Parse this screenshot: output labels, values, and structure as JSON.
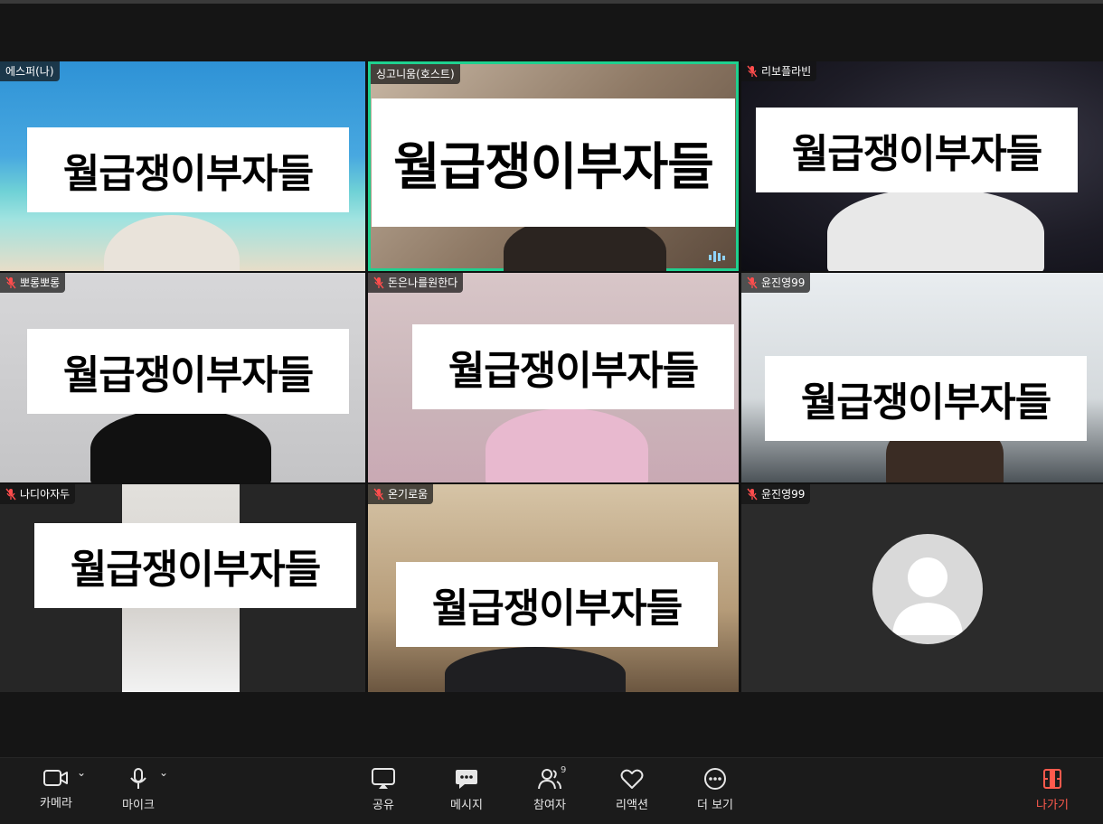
{
  "participants": [
    {
      "name": "에스퍼(나)",
      "muted": false,
      "banner": "월급쟁이부자들"
    },
    {
      "name": "싱고니움(호스트)",
      "muted": false,
      "banner": "월급쟁이부자들",
      "active_speaker": true
    },
    {
      "name": "리보플라빈",
      "muted": true,
      "banner": "월급쟁이부자들"
    },
    {
      "name": "뽀롱뽀롱",
      "muted": true,
      "banner": "월급쟁이부자들"
    },
    {
      "name": "돈은나를원한다",
      "muted": true,
      "banner": "월급쟁이부자들"
    },
    {
      "name": "윤진영99",
      "muted": true,
      "banner": "월급쟁이부자들"
    },
    {
      "name": "나디아자두",
      "muted": true,
      "banner": "월급쟁이부자들"
    },
    {
      "name": "온기로움",
      "muted": true,
      "banner": "월급쟁이부자들"
    },
    {
      "name": "윤진영99",
      "muted": true,
      "video_off": true
    }
  ],
  "toolbar": {
    "camera": "카메라",
    "mic": "마이크",
    "share": "공유",
    "message": "메시지",
    "participants": "참여자",
    "participants_count": "9",
    "reaction": "리액션",
    "more": "더 보기",
    "leave": "나가기"
  },
  "colors": {
    "active_speaker_border": "#1fd08f",
    "leave": "#ff5a4d",
    "muted_mic": "#ff4d4d"
  }
}
